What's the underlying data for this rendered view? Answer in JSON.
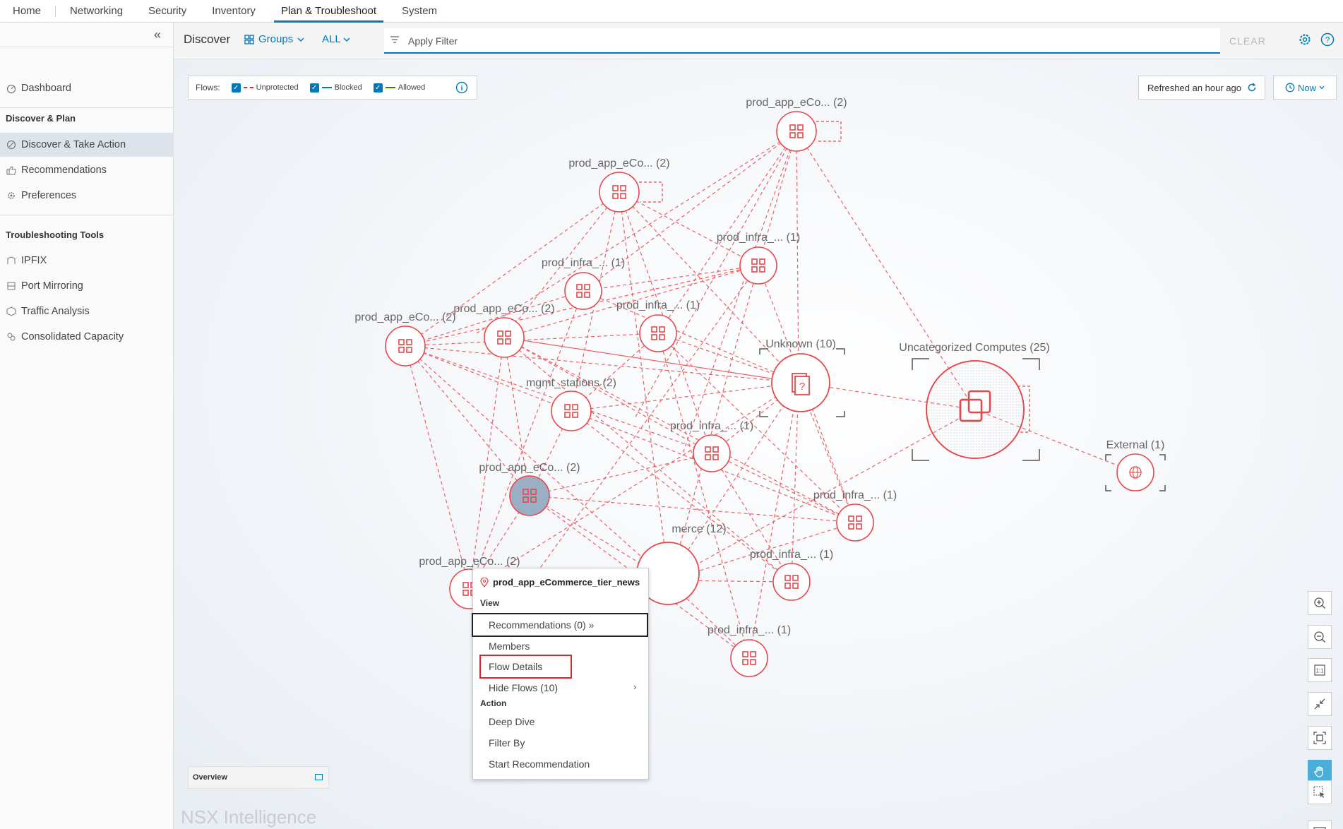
{
  "nav": {
    "tabs": [
      "Home",
      "Networking",
      "Security",
      "Inventory",
      "Plan & Troubleshoot",
      "System"
    ],
    "active": "Plan & Troubleshoot"
  },
  "sidebar": {
    "dashboard": "Dashboard",
    "discover_heading": "Discover & Plan",
    "discover_take_action": "Discover & Take Action",
    "recommendations": "Recommendations",
    "preferences": "Preferences",
    "tools_heading": "Troubleshooting Tools",
    "ipfix": "IPFIX",
    "port_mirroring": "Port Mirroring",
    "traffic_analysis": "Traffic Analysis",
    "consolidated_capacity": "Consolidated Capacity"
  },
  "filterbar": {
    "title": "Discover",
    "groups": "Groups",
    "all": "ALL",
    "filter_placeholder": "Apply Filter",
    "clear": "CLEAR"
  },
  "legend": {
    "flows": "Flows:",
    "unprotected": "Unprotected",
    "blocked": "Blocked",
    "allowed": "Allowed"
  },
  "refresh": {
    "label": "Refreshed an hour ago",
    "now": "Now"
  },
  "colors": {
    "accent": "#0079b8",
    "unprotected": "#e02b2b",
    "blocked": "#0079b8",
    "allowed": "#2f8400",
    "node": "#e8474c"
  },
  "graph": {
    "labels": {
      "n_app_top": "prod_app_eCo... (2)",
      "n_app_2": "prod_app_eCo... (2)",
      "n_infra_1": "prod_infra_... (1)",
      "n_infra_2": "prod_infra_... (1)",
      "n_app_left": "prod_app_eCo... (2)",
      "n_app_mid": "prod_app_eCo... (2)",
      "n_infra_3": "prod_infra_... (1)",
      "n_unknown": "Unknown (10)",
      "n_uncat": "Uncategorized Computes (25)",
      "n_mgmt": "mgmt_stations (2)",
      "n_infra_4": "prod_infra_... (1)",
      "n_external": "External (1)",
      "n_app_sel": "prod_app_eCo... (2)",
      "n_infra_5": "prod_infra_... (1)",
      "n_ecommerce": "merce (12)",
      "n_app_bottom": "prod_app_eCo... (2)",
      "n_infra_6": "prod_infra_... (1)",
      "n_infra_7": "prod_infra_... (1)"
    }
  },
  "context_menu": {
    "title": "prod_app_eCommerce_tier_news",
    "view": "View",
    "recommendations": "Recommendations (0)",
    "members": "Members",
    "flow_details": "Flow Details",
    "hide_flows": "Hide Flows (10)",
    "action": "Action",
    "deep_dive": "Deep Dive",
    "filter_by": "Filter By",
    "start_recommendation": "Start Recommendation"
  },
  "overview": {
    "label": "Overview"
  },
  "brand": "NSX Intelligence"
}
